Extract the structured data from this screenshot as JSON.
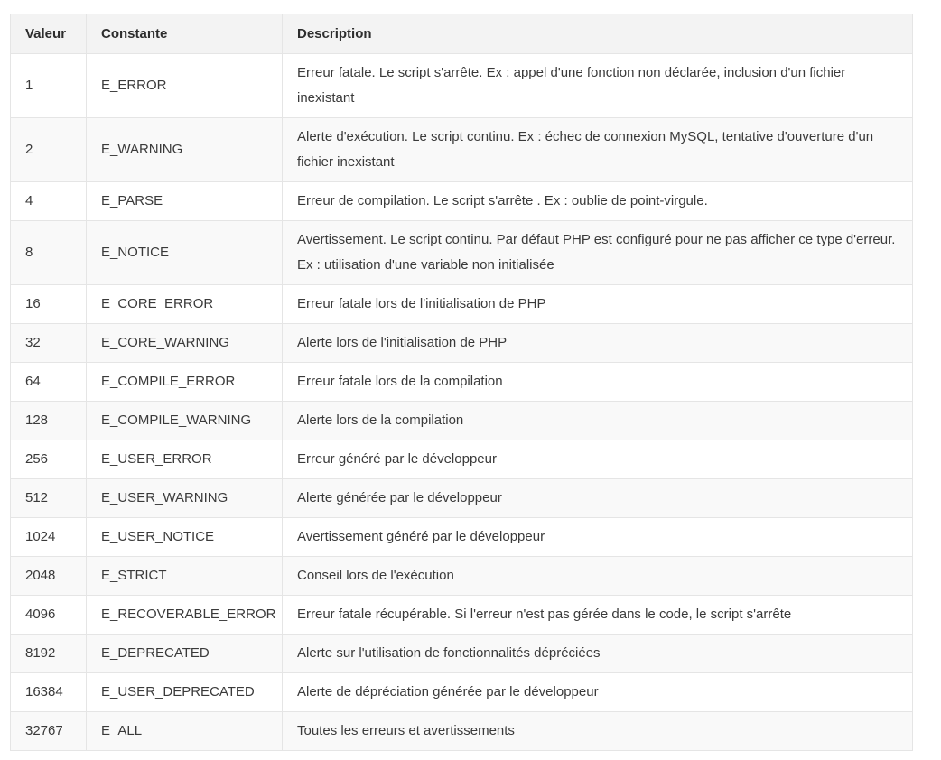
{
  "table": {
    "headers": [
      "Valeur",
      "Constante",
      "Description"
    ],
    "rows": [
      {
        "value": "1",
        "constant": "E_ERROR",
        "description": "Erreur fatale. Le  script s'arrête. Ex : appel d'une fonction non déclarée, inclusion d'un fichier inexistant"
      },
      {
        "value": "2",
        "constant": "E_WARNING",
        "description": "Alerte  d'exécution. Le script continu. Ex : échec de connexion MySQL, tentative d'ouverture d'un fichier  inexistant"
      },
      {
        "value": "4",
        "constant": "E_PARSE",
        "description": "Erreur de  compilation. Le script s'arrête . Ex : oublie de point-virgule."
      },
      {
        "value": "8",
        "constant": "E_NOTICE",
        "description": "Avertissement. Le  script continu. Par défaut PHP est configuré pour ne pas afficher ce type d'erreur. Ex : utilisation d'une variable non initialisée"
      },
      {
        "value": "16",
        "constant": "E_CORE_ERROR",
        "description": "Erreur fatale lors  de l'initialisation de PHP"
      },
      {
        "value": "32",
        "constant": "E_CORE_WARNING",
        "description": "Alerte lors de  l'initialisation de PHP"
      },
      {
        "value": "64",
        "constant": "E_COMPILE_ERROR",
        "description": "Erreur fatale lors  de la compilation"
      },
      {
        "value": "128",
        "constant": "E_COMPILE_WARNING",
        "description": "Alerte lors de la  compilation"
      },
      {
        "value": "256",
        "constant": "E_USER_ERROR",
        "description": "Erreur généré par le développeur"
      },
      {
        "value": "512",
        "constant": "E_USER_WARNING",
        "description": "Alerte générée par le développeur"
      },
      {
        "value": "1024",
        "constant": "E_USER_NOTICE",
        "description": "Avertissement  généré par le développeur"
      },
      {
        "value": "2048",
        "constant": "E_STRICT",
        "description": "Conseil lors de  l'exécution"
      },
      {
        "value": "4096",
        "constant": "E_RECOVERABLE_ERROR",
        "description": "Erreur fatale  récupérable. Si l'erreur n'est pas gérée dans le code, le script s'arrête"
      },
      {
        "value": "8192",
        "constant": "E_DEPRECATED",
        "description": "Alerte sur  l'utilisation de fonctionnalités dépréciées"
      },
      {
        "value": "16384",
        "constant": "E_USER_DEPRECATED",
        "description": "Alerte de  dépréciation générée par le développeur"
      },
      {
        "value": "32767",
        "constant": "E_ALL",
        "description": "Toutes les erreurs  et avertissements"
      }
    ]
  }
}
